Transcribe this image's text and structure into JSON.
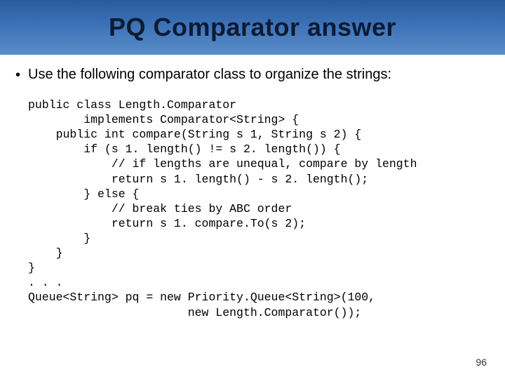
{
  "title": "PQ Comparator answer",
  "bullet": "Use the following comparator class to organize the strings:",
  "code": "public class Length.Comparator\n        implements Comparator<String> {\n    public int compare(String s 1, String s 2) {\n        if (s 1. length() != s 2. length()) {\n            // if lengths are unequal, compare by length\n            return s 1. length() - s 2. length();\n        } else {\n            // break ties by ABC order\n            return s 1. compare.To(s 2);\n        }\n    }\n}\n. . .\nQueue<String> pq = new Priority.Queue<String>(100,\n                       new Length.Comparator());",
  "page_number": "96"
}
